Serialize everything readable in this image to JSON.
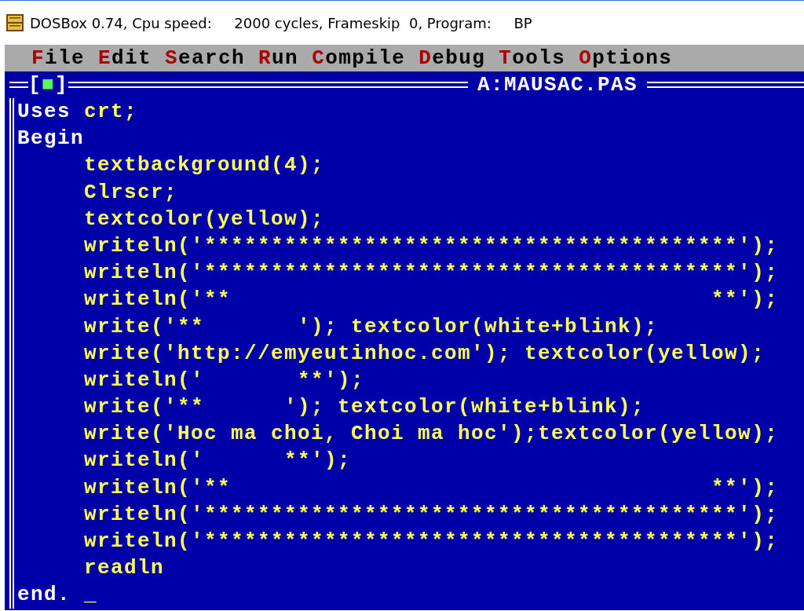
{
  "window": {
    "title": "DOSBox 0.74, Cpu speed:     2000 cycles, Frameskip  0, Program:     BP"
  },
  "menu": [
    {
      "label": "File"
    },
    {
      "label": "Edit"
    },
    {
      "label": "Search"
    },
    {
      "label": "Run"
    },
    {
      "label": "Compile"
    },
    {
      "label": "Debug"
    },
    {
      "label": "Tools"
    },
    {
      "label": "Options"
    }
  ],
  "editor": {
    "close_box": "[■]",
    "title": "A:MAUSAC.PAS",
    "lines": [
      {
        "tokens": [
          {
            "kind": "keyword",
            "text": "Uses"
          },
          {
            "kind": "code",
            "text": " crt;"
          }
        ]
      },
      {
        "tokens": [
          {
            "kind": "keyword",
            "text": "Begin"
          }
        ],
        "children": [
          {
            "tokens": [
              {
                "kind": "code",
                "text": "textbackground(4);"
              }
            ]
          },
          {
            "tokens": [
              {
                "kind": "code",
                "text": "Clrscr;"
              }
            ]
          },
          {
            "tokens": [
              {
                "kind": "code",
                "text": "textcolor(yellow);"
              }
            ]
          },
          {
            "tokens": [
              {
                "kind": "code",
                "text": "writeln('****************************************');"
              }
            ]
          },
          {
            "tokens": [
              {
                "kind": "code",
                "text": "writeln('****************************************');"
              }
            ]
          },
          {
            "tokens": [
              {
                "kind": "code",
                "text": "writeln('**                                    **');"
              }
            ]
          },
          {
            "tokens": [
              {
                "kind": "code",
                "text": "write('**       '); textcolor(white+blink);"
              }
            ]
          },
          {
            "tokens": [
              {
                "kind": "code",
                "text": "write('http://emyeutinhoc.com'); textcolor(yellow);"
              }
            ]
          },
          {
            "tokens": [
              {
                "kind": "code",
                "text": "writeln('       **');"
              }
            ]
          },
          {
            "tokens": [
              {
                "kind": "code",
                "text": "write('**      '); textcolor(white+blink);"
              }
            ]
          },
          {
            "tokens": [
              {
                "kind": "code",
                "text": "write('Hoc ma choi, Choi ma hoc');textcolor(yellow);"
              }
            ]
          },
          {
            "tokens": [
              {
                "kind": "code",
                "text": "writeln('      **');"
              }
            ]
          },
          {
            "tokens": [
              {
                "kind": "code",
                "text": "writeln('**                                    **');"
              }
            ]
          },
          {
            "tokens": [
              {
                "kind": "code",
                "text": "writeln('****************************************');"
              }
            ]
          },
          {
            "tokens": [
              {
                "kind": "code",
                "text": "writeln('****************************************');"
              }
            ]
          },
          {
            "tokens": [
              {
                "kind": "code",
                "text": "readln"
              }
            ]
          }
        ]
      },
      {
        "tokens": [
          {
            "kind": "keyword",
            "text": "end."
          }
        ]
      }
    ],
    "cursor": "_"
  }
}
